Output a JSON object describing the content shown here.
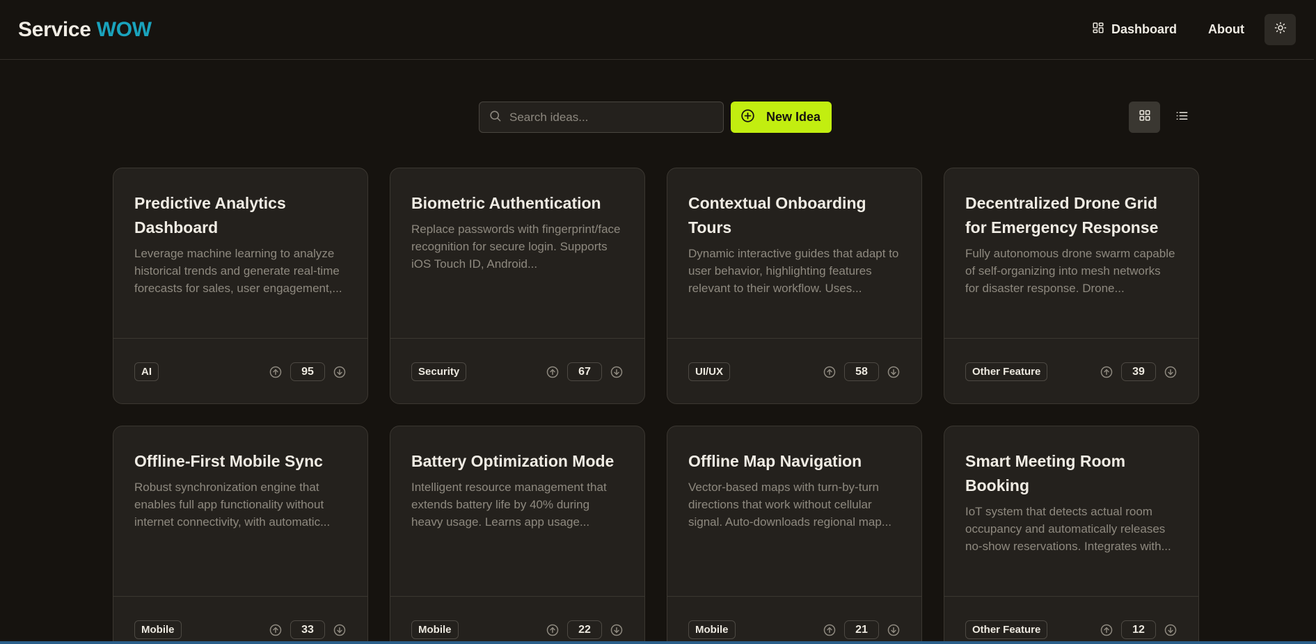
{
  "header": {
    "brand_primary": "Service",
    "brand_accent": "WOW",
    "brand_accent_color": "#1aa3bd",
    "nav": {
      "dashboard_label": "Dashboard",
      "dashboard_icon": "layout-dashboard-icon",
      "about_label": "About",
      "theme_icon": "sun-icon"
    }
  },
  "toolbar": {
    "search_placeholder": "Search ideas...",
    "search_value": "",
    "new_idea_label": "New Idea",
    "new_idea_color": "#c2ee10",
    "view_mode": "grid"
  },
  "ideas": [
    {
      "title": "Predictive Analytics Dashboard",
      "description": "Leverage machine learning to analyze historical trends and generate real-time forecasts for sales, user engagement,...",
      "tag": "AI",
      "votes": "95"
    },
    {
      "title": "Biometric Authentication",
      "description": "Replace passwords with fingerprint/face recognition for secure login. Supports iOS Touch ID, Android...",
      "tag": "Security",
      "votes": "67"
    },
    {
      "title": "Contextual Onboarding Tours",
      "description": "Dynamic interactive guides that adapt to user behavior, highlighting features relevant to their workflow. Uses...",
      "tag": "UI/UX",
      "votes": "58"
    },
    {
      "title": "Decentralized Drone Grid for Emergency Response",
      "description": "Fully autonomous drone swarm capable of self-organizing into mesh networks for disaster response. Drone...",
      "tag": "Other Feature",
      "votes": "39"
    },
    {
      "title": "Offline-First Mobile Sync",
      "description": "Robust synchronization engine that enables full app functionality without internet connectivity, with automatic...",
      "tag": "Mobile",
      "votes": "33"
    },
    {
      "title": "Battery Optimization Mode",
      "description": "Intelligent resource management that extends battery life by 40% during heavy usage. Learns app usage...",
      "tag": "Mobile",
      "votes": "22"
    },
    {
      "title": "Offline Map Navigation",
      "description": "Vector-based maps with turn-by-turn directions that work without cellular signal. Auto-downloads regional map...",
      "tag": "Mobile",
      "votes": "21"
    },
    {
      "title": "Smart Meeting Room Booking",
      "description": "IoT system that detects actual room occupancy and automatically releases no-show reservations. Integrates with...",
      "tag": "Other Feature",
      "votes": "12"
    }
  ]
}
